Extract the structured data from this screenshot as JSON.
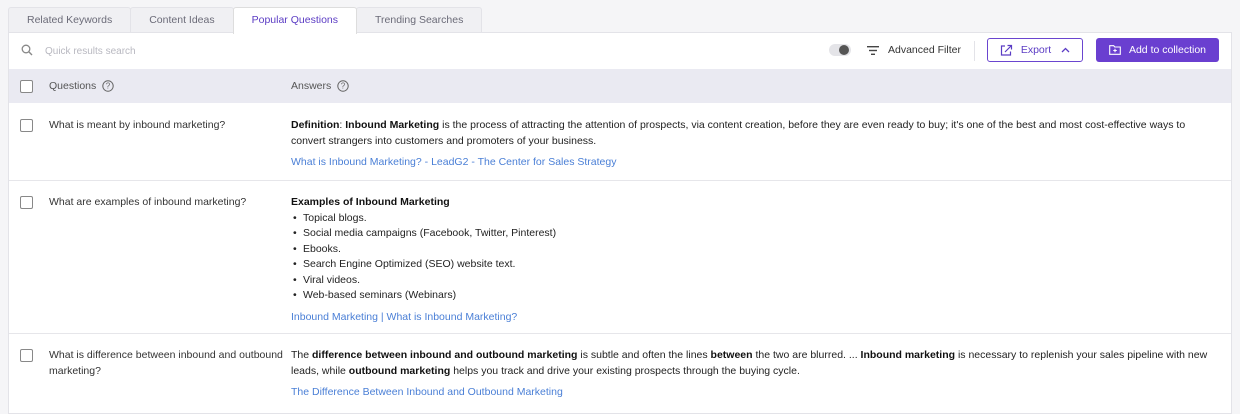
{
  "tabs": [
    {
      "label": "Related Keywords"
    },
    {
      "label": "Content Ideas"
    },
    {
      "label": "Popular Questions",
      "active": true
    },
    {
      "label": "Trending Searches"
    }
  ],
  "toolbar": {
    "search_placeholder": "Quick results search",
    "advanced_filter": "Advanced Filter",
    "export": "Export",
    "add_to_collection": "Add to collection"
  },
  "table": {
    "col_questions": "Questions",
    "col_answers": "Answers",
    "rows": [
      {
        "question": "What is meant by inbound marketing?",
        "answer_parts": [
          {
            "t": "Definition",
            "b": true
          },
          {
            "t": ": "
          },
          {
            "t": "Inbound Marketing",
            "b": true
          },
          {
            "t": " is the process of attracting the attention of prospects, via content creation, before they are even ready to buy; it's one of the best and most cost-effective ways to convert strangers into customers and promoters of your business."
          }
        ],
        "link": "What is Inbound Marketing? - LeadG2 - The Center for Sales Strategy"
      },
      {
        "question": "What are examples of inbound marketing?",
        "answer_heading": "Examples of Inbound Marketing",
        "answer_list": [
          "Topical blogs.",
          "Social media campaigns (Facebook, Twitter, Pinterest)",
          "Ebooks.",
          "Search Engine Optimized (SEO) website text.",
          "Viral videos.",
          "Web-based seminars (Webinars)"
        ],
        "link": "Inbound Marketing | What is Inbound Marketing?"
      },
      {
        "question": "What is difference between inbound and outbound marketing?",
        "answer_parts": [
          {
            "t": "The "
          },
          {
            "t": "difference between inbound and outbound marketing",
            "b": true
          },
          {
            "t": " is subtle and often the lines "
          },
          {
            "t": "between",
            "b": true
          },
          {
            "t": " the two are blurred. ... "
          },
          {
            "t": "Inbound marketing",
            "b": true
          },
          {
            "t": " is necessary to replenish your sales pipeline with new leads, while "
          },
          {
            "t": "outbound marketing",
            "b": true
          },
          {
            "t": " helps you track and drive your existing prospects through the buying cycle."
          }
        ],
        "link": "The Difference Between Inbound and Outbound Marketing"
      }
    ]
  },
  "colors": {
    "accent": "#6a3fd0",
    "link": "#4a7fd6",
    "header_bg": "#eaeaf2"
  }
}
